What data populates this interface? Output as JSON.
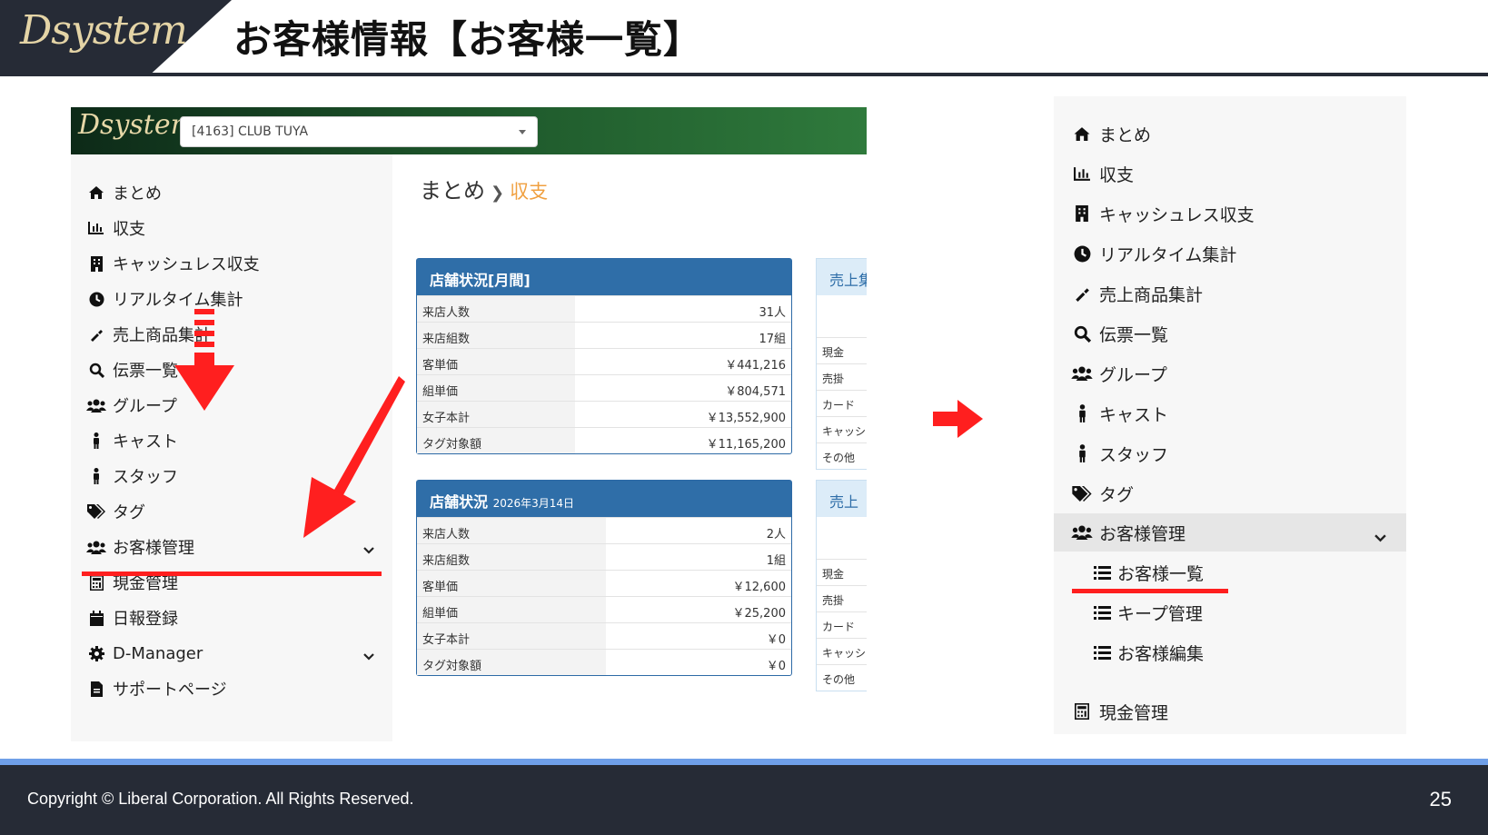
{
  "header": {
    "logo": "Dsystem",
    "title": "お客様情報【お客様一覧】"
  },
  "left_screenshot": {
    "topbar": {
      "logo": "Dsystem",
      "store_select_value": "[4163] CLUB TUYA"
    },
    "sidebar": {
      "items": [
        {
          "label": "まとめ",
          "icon": "home-icon"
        },
        {
          "label": "収支",
          "icon": "bar-chart-icon"
        },
        {
          "label": "キャッシュレス収支",
          "icon": "building-icon"
        },
        {
          "label": "リアルタイム集計",
          "icon": "clock-icon"
        },
        {
          "label": "売上商品集計",
          "icon": "bottle-icon"
        },
        {
          "label": "伝票一覧",
          "icon": "search-icon"
        },
        {
          "label": "グループ",
          "icon": "users-icon"
        },
        {
          "label": "キャスト",
          "icon": "person-icon"
        },
        {
          "label": "スタッフ",
          "icon": "person-icon"
        },
        {
          "label": "タグ",
          "icon": "tags-icon"
        },
        {
          "label": "お客様管理",
          "icon": "users-icon"
        },
        {
          "label": "現金管理",
          "icon": "calculator-icon"
        },
        {
          "label": "日報登録",
          "icon": "calendar-icon"
        },
        {
          "label": "D-Manager",
          "icon": "gear-icon"
        },
        {
          "label": "サポートページ",
          "icon": "file-icon"
        }
      ]
    },
    "breadcrumb": {
      "root": "まとめ",
      "current": "収支"
    },
    "panel_month": {
      "title": "店舗状況[月間]",
      "rows": [
        {
          "k": "来店人数",
          "v": "31人"
        },
        {
          "k": "来店組数",
          "v": "17組"
        },
        {
          "k": "客単価",
          "v": "￥441,216"
        },
        {
          "k": "組単価",
          "v": "￥804,571"
        },
        {
          "k": "女子本計",
          "v": "￥13,552,900"
        },
        {
          "k": "タグ対象額",
          "v": "￥11,165,200"
        }
      ]
    },
    "panel_day": {
      "title": "店舗状況",
      "date": "2026年3月14日",
      "rows": [
        {
          "k": "来店人数",
          "v": "2人"
        },
        {
          "k": "来店組数",
          "v": "1組"
        },
        {
          "k": "客単価",
          "v": "￥12,600"
        },
        {
          "k": "組単価",
          "v": "￥25,200"
        },
        {
          "k": "女子本計",
          "v": "￥0"
        },
        {
          "k": "タグ対象額",
          "v": "￥0"
        }
      ]
    },
    "side_panel_top": {
      "title": "売上集",
      "rows": [
        "現金",
        "売掛",
        "カード",
        "キャッシ",
        "その他"
      ]
    },
    "side_panel_bottom": {
      "title": "売上",
      "rows": [
        "現金",
        "売掛",
        "カード",
        "キャッシ",
        "その他"
      ]
    }
  },
  "right_menu": {
    "items": [
      {
        "label": "まとめ",
        "icon": "home-icon"
      },
      {
        "label": "収支",
        "icon": "bar-chart-icon"
      },
      {
        "label": "キャッシュレス収支",
        "icon": "building-icon"
      },
      {
        "label": "リアルタイム集計",
        "icon": "clock-icon"
      },
      {
        "label": "売上商品集計",
        "icon": "bottle-icon"
      },
      {
        "label": "伝票一覧",
        "icon": "search-icon"
      },
      {
        "label": "グループ",
        "icon": "users-icon"
      },
      {
        "label": "キャスト",
        "icon": "person-icon"
      },
      {
        "label": "スタッフ",
        "icon": "person-icon"
      },
      {
        "label": "タグ",
        "icon": "tags-icon"
      },
      {
        "label": "お客様管理",
        "icon": "users-icon"
      }
    ],
    "submenu": [
      {
        "label": "お客様一覧",
        "icon": "list-icon"
      },
      {
        "label": "キープ管理",
        "icon": "list-icon"
      },
      {
        "label": "お客様編集",
        "icon": "list-icon"
      }
    ],
    "after": {
      "label": "現金管理",
      "icon": "calculator-icon"
    }
  },
  "colors": {
    "annotation": "#ff1f1f",
    "header_dark": "#262b36",
    "panel_blue": "#2f6ea8",
    "breadcrumb_active": "#f0a040"
  },
  "footer": {
    "copyright": "Copyright ©  Liberal Corporation. All Rights Reserved.",
    "page_number": "25"
  }
}
